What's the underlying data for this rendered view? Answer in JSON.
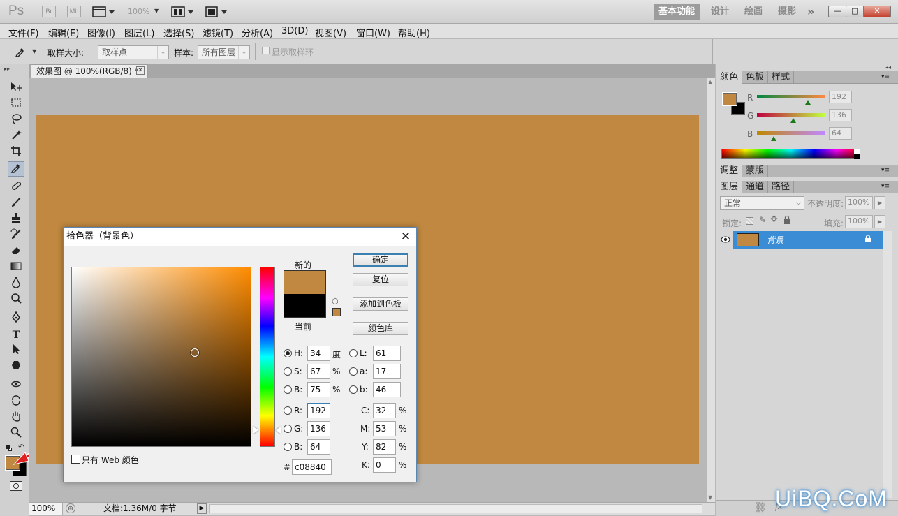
{
  "app": {
    "logo": "Ps",
    "bridge_label": "Br",
    "minibridge_label": "Mb",
    "zoom_level": "100%",
    "workspaces": [
      "基本功能",
      "设计",
      "绘画",
      "摄影"
    ],
    "more_symbol": "»",
    "window_buttons": [
      "—",
      "□",
      "✕"
    ]
  },
  "menubar": {
    "items": [
      "文件(F)",
      "编辑(E)",
      "图像(I)",
      "图层(L)",
      "选择(S)",
      "滤镜(T)",
      "分析(A)",
      "3D(D)",
      "视图(V)",
      "窗口(W)",
      "帮助(H)"
    ]
  },
  "options": {
    "sample_size_label": "取样大小:",
    "sample_size_value": "取样点",
    "sample_label": "样本:",
    "sample_value": "所有图层",
    "show_ring_label": "显示取样环"
  },
  "document": {
    "tab_title": "效果图 @ 100%(RGB/8) *",
    "canvas_color": "#c08840",
    "zoom": "100%",
    "status": "文档:1.36M/0 字节"
  },
  "color_panel": {
    "tabs": [
      "颜色",
      "色板",
      "样式"
    ],
    "channels": [
      {
        "label": "R",
        "value": "192",
        "fraction": 0.753
      },
      {
        "label": "G",
        "value": "136",
        "fraction": 0.533
      },
      {
        "label": "B",
        "value": "64",
        "fraction": 0.251
      }
    ],
    "fg_color": "#c08840",
    "bg_color": "#000000"
  },
  "adjust_panel": {
    "tabs": [
      "调整",
      "蒙版"
    ]
  },
  "layers_panel": {
    "tabs": [
      "图层",
      "通道",
      "路径"
    ],
    "blend_mode": "正常",
    "opacity_label": "不透明度:",
    "opacity_value": "100%",
    "lock_label": "锁定:",
    "fill_label": "填充:",
    "fill_value": "100%",
    "layer_name": "背景"
  },
  "color_picker": {
    "title": "拾色器（背景色）",
    "new_label": "新的",
    "current_label": "当前",
    "new_color": "#c08840",
    "current_color": "#000000",
    "buttons": {
      "ok": "确定",
      "reset": "复位",
      "add_swatch": "添加到色板",
      "libraries": "颜色库"
    },
    "hsb": [
      {
        "label": "H:",
        "value": "34",
        "unit": "度",
        "selected": true
      },
      {
        "label": "S:",
        "value": "67",
        "unit": "%",
        "selected": false
      },
      {
        "label": "B:",
        "value": "75",
        "unit": "%",
        "selected": false
      }
    ],
    "rgb": [
      {
        "label": "R:",
        "value": "192"
      },
      {
        "label": "G:",
        "value": "136"
      },
      {
        "label": "B:",
        "value": "64"
      }
    ],
    "lab": [
      {
        "label": "L:",
        "value": "61"
      },
      {
        "label": "a:",
        "value": "17"
      },
      {
        "label": "b:",
        "value": "46"
      }
    ],
    "cmyk": [
      {
        "label": "C:",
        "value": "32",
        "unit": "%"
      },
      {
        "label": "M:",
        "value": "53",
        "unit": "%"
      },
      {
        "label": "Y:",
        "value": "82",
        "unit": "%"
      },
      {
        "label": "K:",
        "value": "0",
        "unit": "%"
      }
    ],
    "hex_label": "#",
    "hex_value": "c08840",
    "web_only_label": "只有 Web 颜色"
  },
  "watermark": "UiBQ.CoM"
}
